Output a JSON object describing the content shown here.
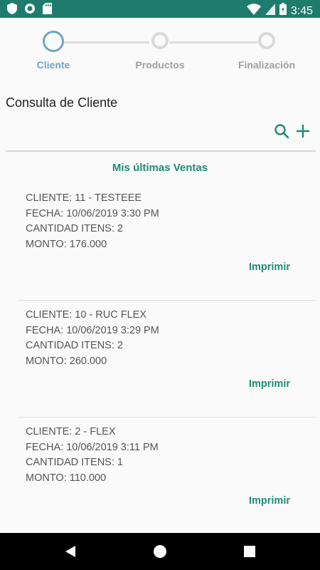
{
  "status_bar": {
    "time": "3:45",
    "icons": [
      "shield-icon",
      "circle-icon",
      "sd-card-icon",
      "wifi-icon",
      "signal-icon",
      "battery-icon"
    ]
  },
  "stepper": {
    "steps": [
      {
        "label": "Cliente",
        "active": true
      },
      {
        "label": "Productos",
        "active": false
      },
      {
        "label": "Finalización",
        "active": false
      }
    ]
  },
  "page": {
    "title": "Consulta de Cliente"
  },
  "section": {
    "title": "Mis últimas Ventas"
  },
  "sales": [
    {
      "cliente": "CLIENTE:   11 - TESTEEE",
      "fecha": "FECHA: 10/06/2019 3:30 PM",
      "cantidad": "CANTIDAD ITENS: 2",
      "monto": "MONTO: 176.000",
      "action": "Imprimir"
    },
    {
      "cliente": "CLIENTE:   10 - RUC FLEX",
      "fecha": "FECHA: 10/06/2019 3:29 PM",
      "cantidad": "CANTIDAD ITENS: 2",
      "monto": "MONTO: 260.000",
      "action": "Imprimir"
    },
    {
      "cliente": "CLIENTE:   2 - FLEX",
      "fecha": "FECHA: 10/06/2019 3:11 PM",
      "cantidad": "CANTIDAD ITENS: 1",
      "monto": "MONTO: 110.000",
      "action": "Imprimir"
    }
  ],
  "colors": {
    "status_bar": "#1f7c6d",
    "accent": "#1f8a76",
    "step_active": "#6fa6c4",
    "step_inactive": "#d9d9d9"
  }
}
